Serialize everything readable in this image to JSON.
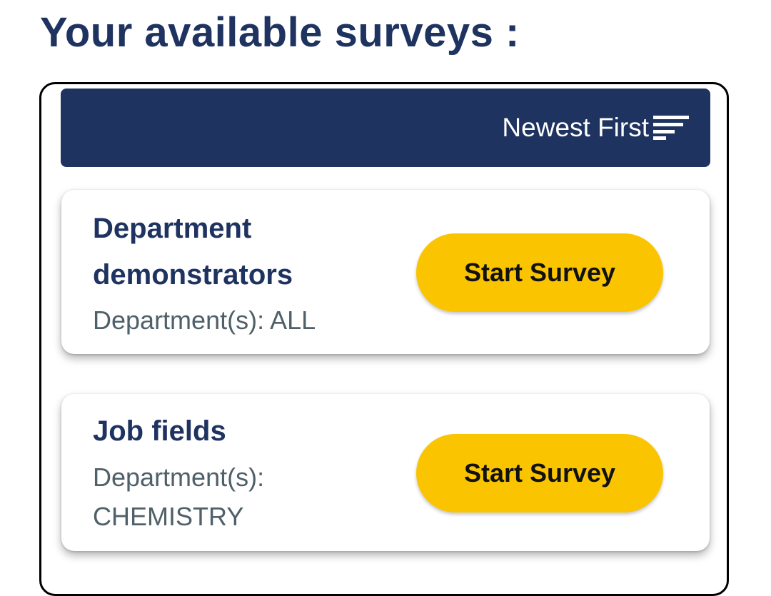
{
  "page": {
    "title": "Your available surveys :"
  },
  "sort": {
    "label": "Newest First",
    "icon": "sort-icon"
  },
  "surveys": [
    {
      "title": "Department demonstrators",
      "departments": "Department(s): ALL",
      "button_label": "Start Survey"
    },
    {
      "title": "Job fields",
      "departments": "Department(s): CHEMISTRY",
      "button_label": "Start Survey"
    }
  ],
  "colors": {
    "primary": "#1f3360",
    "accent": "#fac500",
    "secondary_text": "#4f6068"
  }
}
